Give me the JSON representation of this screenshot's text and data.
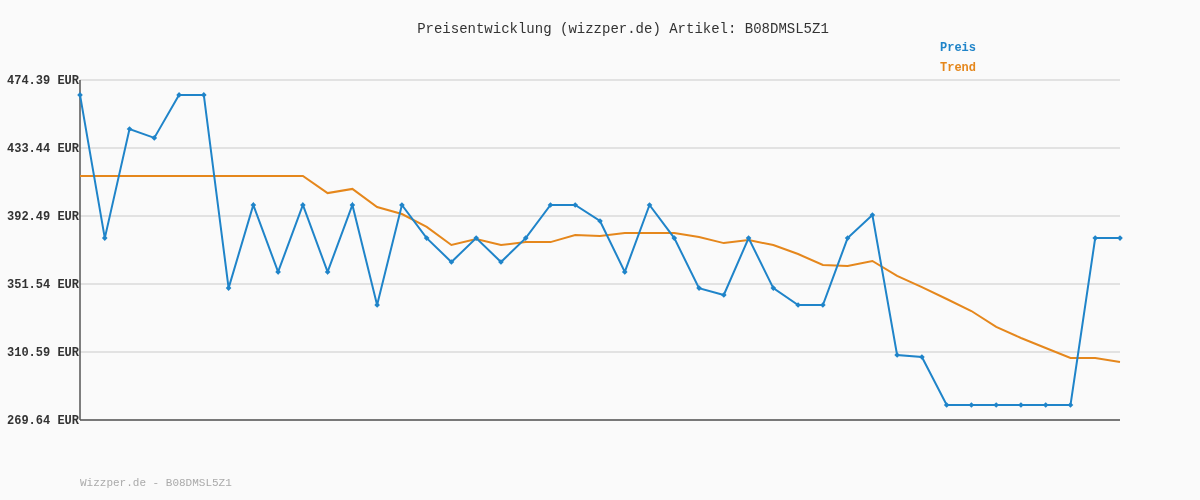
{
  "chart_data": {
    "type": "line",
    "grid": true,
    "title": "Preisentwicklung (wizzper.de) Artikel: B08DMSL5Z1",
    "ylim": [
      269.64,
      474.39
    ],
    "yticks": [
      {
        "value": 269.64,
        "label": "269.64 EUR"
      },
      {
        "value": 310.59,
        "label": "310.59 EUR"
      },
      {
        "value": 351.54,
        "label": "351.54 EUR"
      },
      {
        "value": 392.49,
        "label": "392.49 EUR"
      },
      {
        "value": 433.44,
        "label": "433.44 EUR"
      },
      {
        "value": 474.39,
        "label": "474.39 EUR"
      }
    ],
    "series": [
      {
        "name": "Preis",
        "color": "#1f84c9",
        "marker": "diamond",
        "values": [
          465.4,
          379.2,
          444.9,
          439.5,
          465.4,
          465.4,
          349.1,
          399.1,
          358.8,
          399.1,
          358.8,
          399.1,
          338.9,
          399.1,
          379.2,
          364.8,
          379.2,
          364.8,
          379.2,
          399.1,
          399.1,
          389.5,
          358.8,
          399.1,
          379.2,
          349.1,
          344.9,
          379.2,
          349.1,
          338.9,
          338.9,
          379.2,
          393.1,
          308.8,
          307.6,
          278.7,
          278.7,
          278.7,
          278.7,
          278.7,
          278.7,
          379.2,
          379.2
        ]
      },
      {
        "name": "Trend",
        "color": "#e5871c",
        "values": [
          416.6,
          416.6,
          416.6,
          416.6,
          416.6,
          416.6,
          416.6,
          416.6,
          416.6,
          416.6,
          406.3,
          408.8,
          397.9,
          393.7,
          385.9,
          375.0,
          378.6,
          375.0,
          376.8,
          376.8,
          381.0,
          380.4,
          382.2,
          382.2,
          382.2,
          379.8,
          376.2,
          378.0,
          375.0,
          369.6,
          363.0,
          362.4,
          365.4,
          356.4,
          349.7,
          342.5,
          335.3,
          325.7,
          319.0,
          313.0,
          307.0,
          307.0,
          304.6
        ]
      }
    ]
  },
  "footer": "Wizzper.de - B08DMSL5Z1"
}
